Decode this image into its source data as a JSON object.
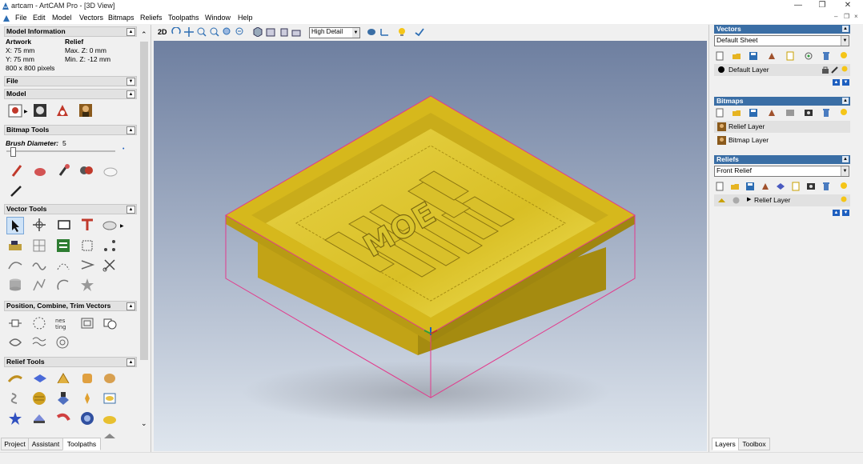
{
  "window": {
    "title": "artcam - ArtCAM Pro - [3D View]",
    "controls": [
      "—",
      "❐",
      "✕"
    ],
    "mdi_controls": [
      "–",
      "❐",
      "×"
    ]
  },
  "menu": [
    "File",
    "Edit",
    "Model",
    "Vectors",
    "Bitmaps",
    "Reliefs",
    "Toolpaths",
    "Window",
    "Help"
  ],
  "model_info": {
    "header": "Model Information",
    "artwork_title": "Artwork",
    "relief_title": "Relief",
    "x": "X: 75 mm",
    "y": "Y: 75 mm",
    "pixels": "800 x 800 pixels",
    "max_z": "Max. Z: 0 mm",
    "min_z": "Min. Z: -12 mm"
  },
  "sections": {
    "file": "File",
    "model": "Model",
    "bitmap_tools": "Bitmap Tools",
    "vector_tools": "Vector Tools",
    "position": "Position, Combine, Trim Vectors",
    "relief_tools": "Relief Tools"
  },
  "brush": {
    "label": "Brush Diameter:",
    "value": "5",
    "level": 0.05
  },
  "left_tabs": [
    "Project",
    "Assistant",
    "Toolpaths"
  ],
  "active_left_tab": "Toolpaths",
  "viewport": {
    "mode_label": "2D",
    "detail_select": "High Detail",
    "bg_top": "#6e7fa0",
    "bg_bottom": "#dfe6ee",
    "relief_color": "#d6b81c",
    "bbox_color": "#e23a8c",
    "engraved_text": "MOE"
  },
  "right": {
    "vectors_header": "Vectors",
    "vectors_sheet": "Default Sheet",
    "vectors_layer": "Default Layer",
    "bitmaps_header": "Bitmaps",
    "bitmap_layers": [
      "Relief Layer",
      "Bitmap Layer"
    ],
    "reliefs_header": "Reliefs",
    "reliefs_select": "Front Relief",
    "relief_layer": "Relief Layer"
  },
  "right_tabs": [
    "Layers",
    "Toolbox"
  ],
  "active_right_tab": "Layers",
  "colors": {
    "header_blue": "#3a6ea5",
    "accent_blue": "#1e5fbf"
  }
}
